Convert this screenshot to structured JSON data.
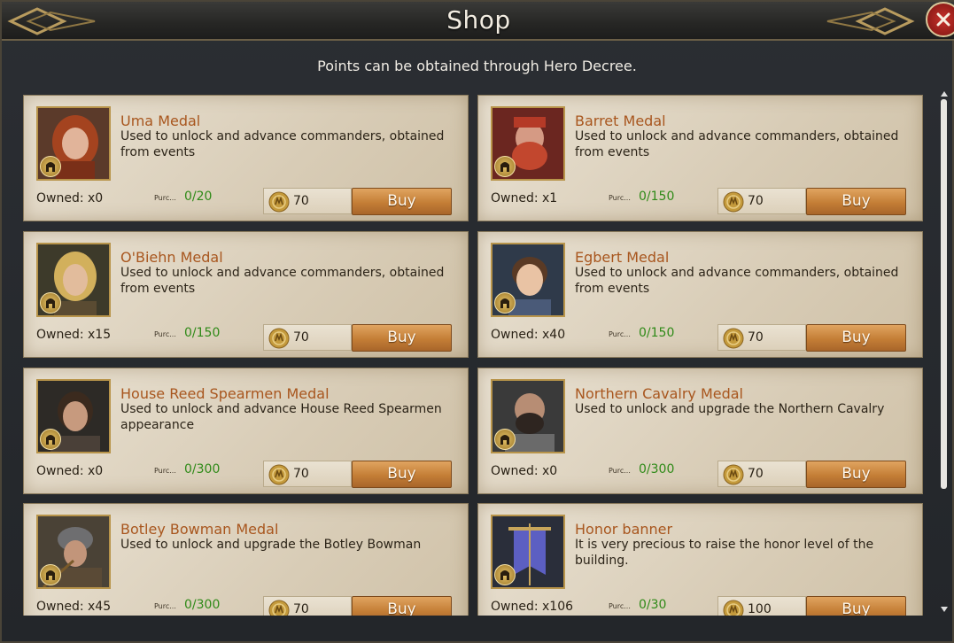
{
  "window": {
    "title": "Shop",
    "close_icon": "close-icon"
  },
  "subtitle": "Points can be obtained through Hero Decree.",
  "items": [
    {
      "name": "Uma Medal",
      "desc": "Used to unlock and advance commanders, obtained from events",
      "owned": "Owned: x0",
      "purch_label": "Purc...",
      "purch_value": "0/20",
      "price": "70",
      "buy": "Buy",
      "portrait": "woman-red-hair"
    },
    {
      "name": "Barret Medal",
      "desc": "Used to unlock and advance commanders, obtained from events",
      "owned": "Owned: x1",
      "purch_label": "Purc...",
      "purch_value": "0/150",
      "price": "70",
      "buy": "Buy",
      "portrait": "red-bearded-man"
    },
    {
      "name": "O'Biehn Medal",
      "desc": "Used to unlock and advance commanders, obtained from events",
      "owned": "Owned: x15",
      "purch_label": "Purc...",
      "purch_value": "0/150",
      "price": "70",
      "buy": "Buy",
      "portrait": "blond-man"
    },
    {
      "name": "Egbert Medal",
      "desc": "Used to unlock and advance commanders, obtained from events",
      "owned": "Owned: x40",
      "purch_label": "Purc...",
      "purch_value": "0/150",
      "price": "70",
      "buy": "Buy",
      "portrait": "young-boy"
    },
    {
      "name": "House Reed Spearmen Medal",
      "desc": "Used to unlock and advance House Reed Spearmen appearance",
      "owned": "Owned: x0",
      "purch_label": "Purc...",
      "purch_value": "0/300",
      "price": "70",
      "buy": "Buy",
      "portrait": "dark-haired-man"
    },
    {
      "name": "Northern Cavalry Medal",
      "desc": "Used to unlock and upgrade the Northern Cavalry",
      "owned": "Owned: x0",
      "purch_label": "Purc...",
      "purch_value": "0/300",
      "price": "70",
      "buy": "Buy",
      "portrait": "bearded-soldier"
    },
    {
      "name": "Botley Bowman Medal",
      "desc": "Used to unlock and upgrade the Botley Bowman",
      "owned": "Owned: x45",
      "purch_label": "Purc...",
      "purch_value": "0/300",
      "price": "70",
      "buy": "Buy",
      "portrait": "helmeted-archer"
    },
    {
      "name": "Honor banner",
      "desc": "It is very precious to raise the honor level of the building.",
      "owned": "Owned: x106",
      "purch_label": "Purc...",
      "purch_value": "0/30",
      "price": "100",
      "buy": "Buy",
      "portrait": "blue-banner"
    }
  ],
  "colors": {
    "accent": "#a8561e",
    "purchase_green": "#2f8a18",
    "buy_button": "#c47e36"
  }
}
